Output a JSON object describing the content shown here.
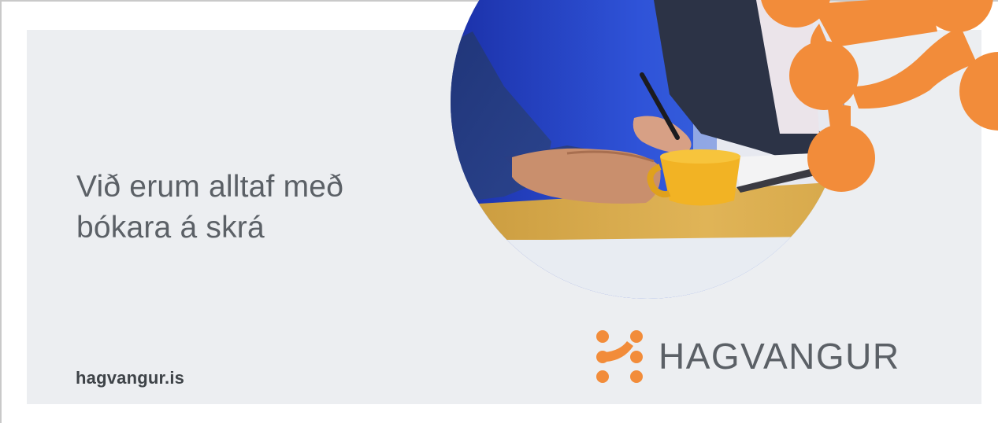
{
  "ad": {
    "headline_line1": "Við erum alltaf með",
    "headline_line2": "bókara á skrá",
    "website": "hagvangur.is"
  },
  "brand": {
    "name": "HAGVANGUR",
    "logo_icon": "hagvangur-molecule-icon",
    "accent_color": "#f28c3a",
    "text_color": "#5b6066",
    "panel_color": "#eceef1"
  },
  "photo": {
    "subject": "office-meeting-photo"
  }
}
